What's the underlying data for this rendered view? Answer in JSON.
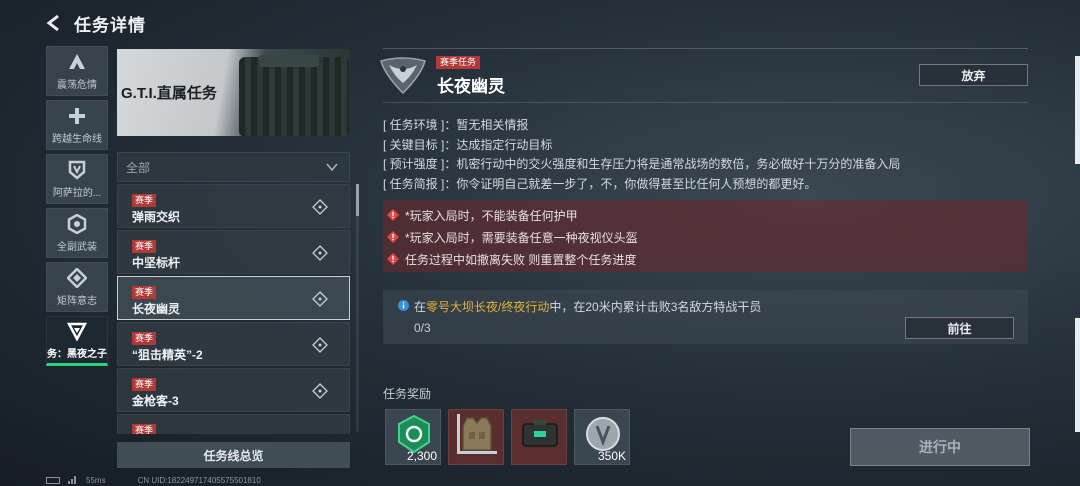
{
  "header": {
    "title": "任务详情"
  },
  "categories": [
    {
      "label": "震荡危情",
      "icon": "triangle-a-icon"
    },
    {
      "label": "跨越生命线",
      "icon": "cross-icon"
    },
    {
      "label": "阿萨拉的...",
      "icon": "shield-icon"
    },
    {
      "label": "全副武装",
      "icon": "hexagon-icon"
    },
    {
      "label": "矩阵意志",
      "icon": "diamond-icon"
    },
    {
      "label": "务：黑夜之子",
      "icon": "v-shield-icon",
      "active": true
    }
  ],
  "banner": {
    "title": "G.T.I.直属任务"
  },
  "filter": {
    "label": "全部"
  },
  "tasks": [
    {
      "tag": "赛季",
      "name": "弹雨交织"
    },
    {
      "tag": "赛季",
      "name": "中坚标杆"
    },
    {
      "tag": "赛季",
      "name": "长夜幽灵",
      "selected": true
    },
    {
      "tag": "赛季",
      "name": "“狙击精英”-2"
    },
    {
      "tag": "赛季",
      "name": "金枪客-3"
    },
    {
      "tag": "赛季",
      "name": ""
    }
  ],
  "overview_button": "任务线总览",
  "status": {
    "ping": "55ms",
    "uid": "CN UID:18224971740557550181​0"
  },
  "detail": {
    "season_tag": "赛季任务",
    "title": "长夜幽灵",
    "abandon_label": "放弃",
    "info": [
      "[ 任务环境 ]：暂无相关情报",
      "[ 关键目标 ]：达成指定行动目标",
      "[ 预计强度 ]：机密行动中的交火强度和生存压力将是通常战场的数倍，务必做好十万分的准备入局",
      "[ 任务简报 ]：你令证明自己就差一步了，不，你做得甚至比任何人预想的都更好。"
    ],
    "warnings": [
      "*玩家入局时，不能装备任何护甲",
      "*玩家入局时，需要装备任意一种夜视仪头盔",
      "任务过程中如撤离失败 则重置整个任务进度"
    ],
    "objective": {
      "prefix": "在",
      "highlight": "零号大坝长夜/终夜行动",
      "suffix": "中，在20米内累计击败3名敌方特战干员",
      "progress": "0/3",
      "goto_label": "前往"
    },
    "rewards_label": "任务奖励",
    "rewards": [
      {
        "icon": "xp-badge-icon",
        "qty": "2,300"
      },
      {
        "icon": "armor-vest-icon",
        "qty": ""
      },
      {
        "icon": "supply-case-icon",
        "qty": ""
      },
      {
        "icon": "coin-icon",
        "qty": "350K"
      }
    ],
    "status_button": "进行中"
  },
  "colors": {
    "accent_green": "#2fd17a",
    "tag_red": "#b03a38",
    "highlight_gold": "#e2b33a"
  }
}
